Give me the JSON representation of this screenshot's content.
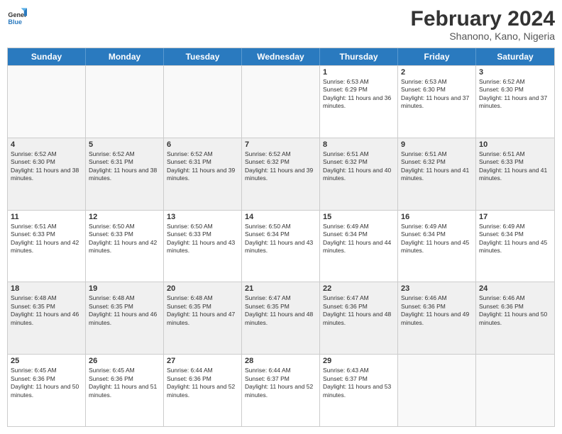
{
  "header": {
    "logo_line1": "General",
    "logo_line2": "Blue",
    "month_year": "February 2024",
    "location": "Shanono, Kano, Nigeria"
  },
  "days_of_week": [
    "Sunday",
    "Monday",
    "Tuesday",
    "Wednesday",
    "Thursday",
    "Friday",
    "Saturday"
  ],
  "weeks": [
    [
      {
        "day": "",
        "info": "",
        "empty": true
      },
      {
        "day": "",
        "info": "",
        "empty": true
      },
      {
        "day": "",
        "info": "",
        "empty": true
      },
      {
        "day": "",
        "info": "",
        "empty": true
      },
      {
        "day": "1",
        "info": "Sunrise: 6:53 AM\nSunset: 6:29 PM\nDaylight: 11 hours and 36 minutes."
      },
      {
        "day": "2",
        "info": "Sunrise: 6:53 AM\nSunset: 6:30 PM\nDaylight: 11 hours and 37 minutes."
      },
      {
        "day": "3",
        "info": "Sunrise: 6:52 AM\nSunset: 6:30 PM\nDaylight: 11 hours and 37 minutes."
      }
    ],
    [
      {
        "day": "4",
        "info": "Sunrise: 6:52 AM\nSunset: 6:30 PM\nDaylight: 11 hours and 38 minutes."
      },
      {
        "day": "5",
        "info": "Sunrise: 6:52 AM\nSunset: 6:31 PM\nDaylight: 11 hours and 38 minutes."
      },
      {
        "day": "6",
        "info": "Sunrise: 6:52 AM\nSunset: 6:31 PM\nDaylight: 11 hours and 39 minutes."
      },
      {
        "day": "7",
        "info": "Sunrise: 6:52 AM\nSunset: 6:32 PM\nDaylight: 11 hours and 39 minutes."
      },
      {
        "day": "8",
        "info": "Sunrise: 6:51 AM\nSunset: 6:32 PM\nDaylight: 11 hours and 40 minutes."
      },
      {
        "day": "9",
        "info": "Sunrise: 6:51 AM\nSunset: 6:32 PM\nDaylight: 11 hours and 41 minutes."
      },
      {
        "day": "10",
        "info": "Sunrise: 6:51 AM\nSunset: 6:33 PM\nDaylight: 11 hours and 41 minutes."
      }
    ],
    [
      {
        "day": "11",
        "info": "Sunrise: 6:51 AM\nSunset: 6:33 PM\nDaylight: 11 hours and 42 minutes."
      },
      {
        "day": "12",
        "info": "Sunrise: 6:50 AM\nSunset: 6:33 PM\nDaylight: 11 hours and 42 minutes."
      },
      {
        "day": "13",
        "info": "Sunrise: 6:50 AM\nSunset: 6:33 PM\nDaylight: 11 hours and 43 minutes."
      },
      {
        "day": "14",
        "info": "Sunrise: 6:50 AM\nSunset: 6:34 PM\nDaylight: 11 hours and 43 minutes."
      },
      {
        "day": "15",
        "info": "Sunrise: 6:49 AM\nSunset: 6:34 PM\nDaylight: 11 hours and 44 minutes."
      },
      {
        "day": "16",
        "info": "Sunrise: 6:49 AM\nSunset: 6:34 PM\nDaylight: 11 hours and 45 minutes."
      },
      {
        "day": "17",
        "info": "Sunrise: 6:49 AM\nSunset: 6:34 PM\nDaylight: 11 hours and 45 minutes."
      }
    ],
    [
      {
        "day": "18",
        "info": "Sunrise: 6:48 AM\nSunset: 6:35 PM\nDaylight: 11 hours and 46 minutes."
      },
      {
        "day": "19",
        "info": "Sunrise: 6:48 AM\nSunset: 6:35 PM\nDaylight: 11 hours and 46 minutes."
      },
      {
        "day": "20",
        "info": "Sunrise: 6:48 AM\nSunset: 6:35 PM\nDaylight: 11 hours and 47 minutes."
      },
      {
        "day": "21",
        "info": "Sunrise: 6:47 AM\nSunset: 6:35 PM\nDaylight: 11 hours and 48 minutes."
      },
      {
        "day": "22",
        "info": "Sunrise: 6:47 AM\nSunset: 6:36 PM\nDaylight: 11 hours and 48 minutes."
      },
      {
        "day": "23",
        "info": "Sunrise: 6:46 AM\nSunset: 6:36 PM\nDaylight: 11 hours and 49 minutes."
      },
      {
        "day": "24",
        "info": "Sunrise: 6:46 AM\nSunset: 6:36 PM\nDaylight: 11 hours and 50 minutes."
      }
    ],
    [
      {
        "day": "25",
        "info": "Sunrise: 6:45 AM\nSunset: 6:36 PM\nDaylight: 11 hours and 50 minutes."
      },
      {
        "day": "26",
        "info": "Sunrise: 6:45 AM\nSunset: 6:36 PM\nDaylight: 11 hours and 51 minutes."
      },
      {
        "day": "27",
        "info": "Sunrise: 6:44 AM\nSunset: 6:36 PM\nDaylight: 11 hours and 52 minutes."
      },
      {
        "day": "28",
        "info": "Sunrise: 6:44 AM\nSunset: 6:37 PM\nDaylight: 11 hours and 52 minutes."
      },
      {
        "day": "29",
        "info": "Sunrise: 6:43 AM\nSunset: 6:37 PM\nDaylight: 11 hours and 53 minutes."
      },
      {
        "day": "",
        "info": "",
        "empty": true
      },
      {
        "day": "",
        "info": "",
        "empty": true
      }
    ]
  ]
}
